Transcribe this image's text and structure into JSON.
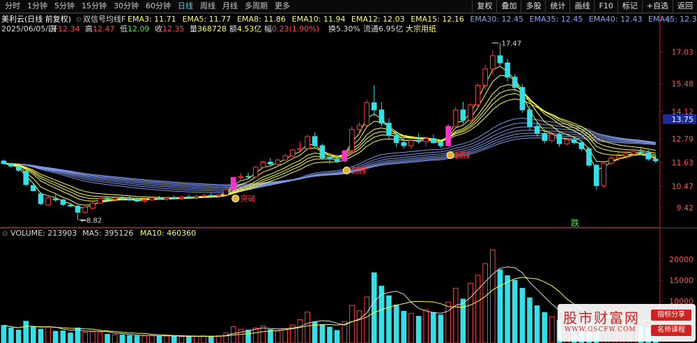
{
  "toolbar": {
    "periods": [
      {
        "label": "分时",
        "active": false
      },
      {
        "label": "1分钟",
        "active": false
      },
      {
        "label": "5分钟",
        "active": false
      },
      {
        "label": "15分钟",
        "active": false
      },
      {
        "label": "30分钟",
        "active": false
      },
      {
        "label": "60分钟",
        "active": false
      },
      {
        "label": "日线",
        "active": true
      },
      {
        "label": "周线",
        "active": false
      },
      {
        "label": "月线",
        "active": false
      },
      {
        "label": "多周期",
        "active": false
      },
      {
        "label": "更多",
        "active": false
      }
    ],
    "tools": [
      "复权",
      "叠加",
      "多股",
      "统计",
      "画线",
      "F10",
      "标记",
      "+自选",
      "返回"
    ]
  },
  "info": {
    "stock_title": "美利云(日线 前复权)",
    "indicator_name": "双信号均线F",
    "ema_values": [
      {
        "label": "EMA3: 11.71",
        "color": "#ffff66"
      },
      {
        "label": "EMA5: 11.77",
        "color": "#ffff66"
      },
      {
        "label": "EMA8: 11.86",
        "color": "#ffff66"
      },
      {
        "label": "EMA10: 11.94",
        "color": "#ffff66"
      },
      {
        "label": "EMA12: 12.03",
        "color": "#ffff66"
      },
      {
        "label": "EMA15: 12.16",
        "color": "#ffff66"
      },
      {
        "label": "EMA30: 12.45",
        "color": "#8fa7ee"
      },
      {
        "label": "EMA35: 12.45",
        "color": "#8fa7ee"
      },
      {
        "label": "EMA40: 12.43",
        "color": "#8fa7ee"
      },
      {
        "label": "EMA45: 12.39",
        "color": "#8fa7ee"
      },
      {
        "label": "EMA50:",
        "color": "#8fa7ee"
      }
    ],
    "date": "2025/06/05/四",
    "quote": [
      {
        "label": "开",
        "value": "12.34",
        "color": "#ff4444"
      },
      {
        "label": "高",
        "value": "12.47",
        "color": "#ff4444"
      },
      {
        "label": "低",
        "value": "12.09",
        "color": "#44ee44"
      },
      {
        "label": "收",
        "value": "12.35",
        "color": "#ff4444"
      },
      {
        "label": "量",
        "value": "368728",
        "color": "#ffff66"
      },
      {
        "label": "额",
        "value": "4.53亿",
        "color": "#ffff66"
      },
      {
        "label": "幅",
        "value": "0.23(1.90%)",
        "color": "#ff4444"
      },
      {
        "label": "换",
        "value": "5.30%",
        "color": "#dddddd"
      },
      {
        "label": "流通",
        "value": "6.95亿",
        "color": "#dddddd"
      },
      {
        "label": "",
        "value": "大宗用纸",
        "color": "#ffff66"
      }
    ]
  },
  "price_axis": {
    "ticks": [
      "17.03",
      "15.48",
      "14.12",
      "12.79",
      "11.63",
      "10.47",
      "9.42"
    ],
    "current_price": "13.75",
    "high_label": "17.47",
    "low_label": "8.82"
  },
  "signals": [
    {
      "label": "突破",
      "color": "#ff3333"
    },
    {
      "label": "回踩",
      "color": "#ff3333"
    },
    {
      "label": "回踩",
      "color": "#ff3333"
    }
  ],
  "fall_label": "跌",
  "volume": {
    "header": [
      {
        "text": "VOLUME: 213903",
        "color": "#dddddd"
      },
      {
        "text": "MA5: 395126",
        "color": "#dddddd"
      },
      {
        "text": "MA10: 460360",
        "color": "#ffff66"
      }
    ],
    "ticks": [
      "20000",
      "15000",
      "10000",
      "5000"
    ]
  },
  "watermark": {
    "name": "股市财富网",
    "url": "WWW.GSCFW.COM",
    "tag1": "指标分享",
    "tag2": "名师课程"
  },
  "colors": {
    "up": "#ff3c3c",
    "down": "#33e0e8",
    "signal_bar": "#ff33cc",
    "ema_short": "#ffff44",
    "ema_long": "#7f98e8"
  },
  "chart_data": {
    "type": "candlestick",
    "price_range": [
      8.6,
      17.8
    ],
    "volume_range": [
      0,
      24000
    ],
    "candles": [
      {
        "o": 11.7,
        "h": 11.78,
        "l": 11.52,
        "c": 11.58,
        "v": 4200
      },
      {
        "o": 11.55,
        "h": 11.62,
        "l": 11.38,
        "c": 11.45,
        "v": 3600
      },
      {
        "o": 11.42,
        "h": 11.48,
        "l": 11.18,
        "c": 11.25,
        "v": 3100
      },
      {
        "o": 11.2,
        "h": 11.25,
        "l": 10.45,
        "c": 10.55,
        "v": 5200
      },
      {
        "o": 10.5,
        "h": 10.58,
        "l": 10.2,
        "c": 10.25,
        "v": 3800
      },
      {
        "o": 10.1,
        "h": 10.18,
        "l": 9.55,
        "c": 9.62,
        "v": 3300
      },
      {
        "o": 9.55,
        "h": 10.0,
        "l": 9.5,
        "c": 9.9,
        "v": 3900
      },
      {
        "o": 9.85,
        "h": 10.1,
        "l": 9.7,
        "c": 9.8,
        "v": 2800
      },
      {
        "o": 9.8,
        "h": 9.86,
        "l": 9.5,
        "c": 9.58,
        "v": 2900
      },
      {
        "o": 9.55,
        "h": 9.6,
        "l": 9.45,
        "c": 9.5,
        "v": 2400
      },
      {
        "o": 9.5,
        "h": 9.55,
        "l": 8.82,
        "c": 9.2,
        "v": 3600
      },
      {
        "o": 9.2,
        "h": 9.55,
        "l": 9.15,
        "c": 9.45,
        "v": 2600
      },
      {
        "o": 9.4,
        "h": 9.7,
        "l": 9.35,
        "c": 9.65,
        "v": 2700
      },
      {
        "o": 9.65,
        "h": 9.92,
        "l": 9.6,
        "c": 9.88,
        "v": 2500
      },
      {
        "o": 9.88,
        "h": 10.0,
        "l": 9.75,
        "c": 9.82,
        "v": 2100
      },
      {
        "o": 9.82,
        "h": 9.95,
        "l": 9.72,
        "c": 9.9,
        "v": 2000
      },
      {
        "o": 9.9,
        "h": 10.05,
        "l": 9.8,
        "c": 9.85,
        "v": 1900
      },
      {
        "o": 9.85,
        "h": 9.98,
        "l": 9.75,
        "c": 9.8,
        "v": 1800
      },
      {
        "o": 9.8,
        "h": 9.92,
        "l": 9.7,
        "c": 9.74,
        "v": 1700
      },
      {
        "o": 9.74,
        "h": 9.86,
        "l": 9.66,
        "c": 9.8,
        "v": 1700
      },
      {
        "o": 9.8,
        "h": 9.95,
        "l": 9.74,
        "c": 9.9,
        "v": 1800
      },
      {
        "o": 9.9,
        "h": 10.0,
        "l": 9.8,
        "c": 9.84,
        "v": 1600
      },
      {
        "o": 9.84,
        "h": 9.95,
        "l": 9.75,
        "c": 9.9,
        "v": 1700
      },
      {
        "o": 9.9,
        "h": 10.02,
        "l": 9.82,
        "c": 9.88,
        "v": 1600
      },
      {
        "o": 9.88,
        "h": 10.0,
        "l": 9.8,
        "c": 9.95,
        "v": 1500
      },
      {
        "o": 9.95,
        "h": 10.08,
        "l": 9.86,
        "c": 9.92,
        "v": 1500
      },
      {
        "o": 9.92,
        "h": 10.05,
        "l": 9.84,
        "c": 9.98,
        "v": 1600
      },
      {
        "o": 9.98,
        "h": 10.1,
        "l": 9.9,
        "c": 10.02,
        "v": 1700
      },
      {
        "o": 10.02,
        "h": 10.15,
        "l": 9.95,
        "c": 10.0,
        "v": 1600
      },
      {
        "o": 10.0,
        "h": 10.1,
        "l": 9.92,
        "c": 10.05,
        "v": 1700
      },
      {
        "o": 10.05,
        "h": 10.35,
        "l": 10.0,
        "c": 10.3,
        "v": 2400
      },
      {
        "o": 10.3,
        "h": 10.92,
        "l": 10.28,
        "c": 10.9,
        "v": 3900,
        "signal": true
      },
      {
        "o": 10.9,
        "h": 11.1,
        "l": 10.8,
        "c": 10.95,
        "v": 3300
      },
      {
        "o": 10.95,
        "h": 11.15,
        "l": 10.85,
        "c": 10.92,
        "v": 3100
      },
      {
        "o": 10.92,
        "h": 11.45,
        "l": 10.9,
        "c": 11.4,
        "v": 3600
      },
      {
        "o": 11.4,
        "h": 11.7,
        "l": 11.35,
        "c": 11.65,
        "v": 4100
      },
      {
        "o": 11.65,
        "h": 11.85,
        "l": 11.5,
        "c": 11.55,
        "v": 3200
      },
      {
        "o": 11.55,
        "h": 11.8,
        "l": 11.5,
        "c": 11.75,
        "v": 2900
      },
      {
        "o": 11.75,
        "h": 12.05,
        "l": 11.7,
        "c": 11.95,
        "v": 3400
      },
      {
        "o": 11.95,
        "h": 12.3,
        "l": 11.9,
        "c": 12.25,
        "v": 4300
      },
      {
        "o": 12.25,
        "h": 12.65,
        "l": 12.2,
        "c": 12.3,
        "v": 5600
      },
      {
        "o": 12.3,
        "h": 13.0,
        "l": 12.25,
        "c": 12.9,
        "v": 7400
      },
      {
        "o": 12.9,
        "h": 13.1,
        "l": 12.35,
        "c": 12.45,
        "v": 5000
      },
      {
        "o": 12.45,
        "h": 12.55,
        "l": 11.75,
        "c": 11.85,
        "v": 4400
      },
      {
        "o": 11.85,
        "h": 11.95,
        "l": 11.55,
        "c": 11.8,
        "v": 3800
      },
      {
        "o": 11.8,
        "h": 12.0,
        "l": 11.6,
        "c": 11.7,
        "v": 3000
      },
      {
        "o": 11.7,
        "h": 12.25,
        "l": 11.65,
        "c": 12.2,
        "v": 5100,
        "signal": true
      },
      {
        "o": 12.2,
        "h": 13.4,
        "l": 12.1,
        "c": 13.25,
        "v": 9000
      },
      {
        "o": 13.25,
        "h": 13.6,
        "l": 13.0,
        "c": 13.45,
        "v": 7700
      },
      {
        "o": 13.45,
        "h": 14.7,
        "l": 13.4,
        "c": 14.55,
        "v": 11000
      },
      {
        "o": 14.55,
        "h": 15.4,
        "l": 13.9,
        "c": 14.2,
        "v": 16800
      },
      {
        "o": 14.2,
        "h": 14.6,
        "l": 13.4,
        "c": 13.55,
        "v": 13600
      },
      {
        "o": 13.55,
        "h": 13.8,
        "l": 12.8,
        "c": 12.95,
        "v": 11300
      },
      {
        "o": 12.95,
        "h": 13.1,
        "l": 12.4,
        "c": 12.6,
        "v": 9100
      },
      {
        "o": 12.6,
        "h": 12.95,
        "l": 12.3,
        "c": 12.45,
        "v": 7600
      },
      {
        "o": 12.45,
        "h": 12.8,
        "l": 12.3,
        "c": 12.7,
        "v": 7100
      },
      {
        "o": 12.7,
        "h": 13.05,
        "l": 12.55,
        "c": 12.65,
        "v": 6400
      },
      {
        "o": 12.65,
        "h": 12.9,
        "l": 12.4,
        "c": 12.8,
        "v": 8000
      },
      {
        "o": 12.8,
        "h": 13.0,
        "l": 12.55,
        "c": 12.6,
        "v": 7300
      },
      {
        "o": 12.6,
        "h": 12.75,
        "l": 12.35,
        "c": 12.45,
        "v": 6700
      },
      {
        "o": 12.45,
        "h": 13.5,
        "l": 12.4,
        "c": 13.4,
        "v": 9800,
        "signal": true
      },
      {
        "o": 13.4,
        "h": 14.35,
        "l": 13.3,
        "c": 14.2,
        "v": 13100
      },
      {
        "o": 14.2,
        "h": 14.6,
        "l": 13.5,
        "c": 13.7,
        "v": 10500
      },
      {
        "o": 13.7,
        "h": 14.55,
        "l": 13.6,
        "c": 14.45,
        "v": 14300
      },
      {
        "o": 14.45,
        "h": 15.5,
        "l": 14.3,
        "c": 15.4,
        "v": 16200
      },
      {
        "o": 15.4,
        "h": 16.4,
        "l": 15.2,
        "c": 16.2,
        "v": 19000
      },
      {
        "o": 16.2,
        "h": 17.1,
        "l": 15.9,
        "c": 16.85,
        "v": 22300
      },
      {
        "o": 16.85,
        "h": 17.47,
        "l": 16.3,
        "c": 16.5,
        "v": 17500
      },
      {
        "o": 16.5,
        "h": 16.7,
        "l": 15.6,
        "c": 15.8,
        "v": 16100
      },
      {
        "o": 15.8,
        "h": 15.95,
        "l": 15.1,
        "c": 15.3,
        "v": 15000
      },
      {
        "o": 15.3,
        "h": 15.45,
        "l": 14.05,
        "c": 14.2,
        "v": 13100
      },
      {
        "o": 14.2,
        "h": 14.4,
        "l": 13.2,
        "c": 13.4,
        "v": 10800
      },
      {
        "o": 13.4,
        "h": 13.6,
        "l": 12.9,
        "c": 13.05,
        "v": 8900
      },
      {
        "o": 13.05,
        "h": 13.25,
        "l": 12.55,
        "c": 12.7,
        "v": 7300
      },
      {
        "o": 12.7,
        "h": 13.1,
        "l": 12.6,
        "c": 13.0,
        "v": 6300
      },
      {
        "o": 13.0,
        "h": 13.15,
        "l": 12.4,
        "c": 12.55,
        "v": 5500
      },
      {
        "o": 12.55,
        "h": 12.85,
        "l": 12.45,
        "c": 12.75,
        "v": 5000
      },
      {
        "o": 12.75,
        "h": 12.9,
        "l": 12.5,
        "c": 12.6,
        "v": 4600
      },
      {
        "o": 12.6,
        "h": 12.7,
        "l": 12.2,
        "c": 12.3,
        "v": 4300
      },
      {
        "o": 12.3,
        "h": 12.4,
        "l": 11.4,
        "c": 11.5,
        "v": 5800
      },
      {
        "o": 11.5,
        "h": 11.55,
        "l": 10.3,
        "c": 10.5,
        "v": 7600
      },
      {
        "o": 10.5,
        "h": 11.7,
        "l": 10.4,
        "c": 11.6,
        "v": 8400
      },
      {
        "o": 11.6,
        "h": 12.0,
        "l": 11.5,
        "c": 11.85,
        "v": 6300
      },
      {
        "o": 11.85,
        "h": 12.15,
        "l": 11.7,
        "c": 11.95,
        "v": 5200
      },
      {
        "o": 11.95,
        "h": 12.2,
        "l": 11.8,
        "c": 12.05,
        "v": 4600
      },
      {
        "o": 12.05,
        "h": 12.3,
        "l": 11.95,
        "c": 12.15,
        "v": 4300
      },
      {
        "o": 12.15,
        "h": 12.4,
        "l": 12.0,
        "c": 12.1,
        "v": 4000
      },
      {
        "o": 12.1,
        "h": 12.25,
        "l": 11.7,
        "c": 11.8,
        "v": 3700
      },
      {
        "o": 11.8,
        "h": 12.0,
        "l": 11.6,
        "c": 11.71,
        "v": 2100
      }
    ]
  }
}
